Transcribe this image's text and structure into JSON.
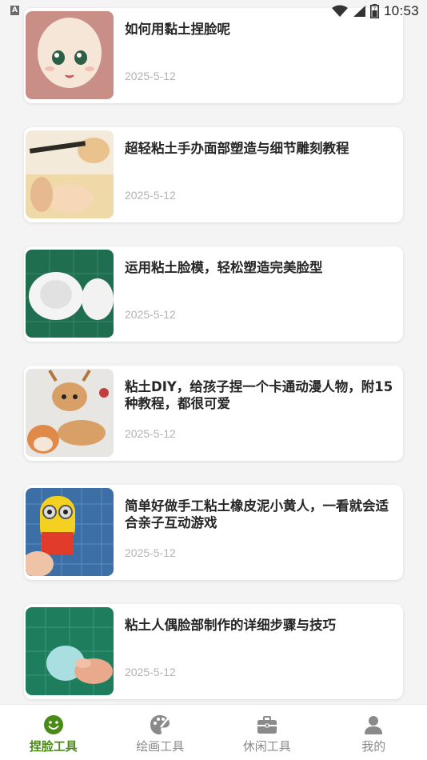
{
  "status_bar": {
    "badge": "A",
    "time": "10:53"
  },
  "articles": [
    {
      "title": "如何用黏土捏脸呢",
      "date": "2025-5-12",
      "thumb_icon": "clay-doll-face-image"
    },
    {
      "title": "超轻粘土手办面部塑造与细节雕刻教程",
      "date": "2025-5-12",
      "thumb_icon": "clay-face-sculpting-image"
    },
    {
      "title": "运用粘土脸模，轻松塑造完美脸型",
      "date": "2025-5-12",
      "thumb_icon": "clay-face-mold-image"
    },
    {
      "title": "粘土DIY，给孩子捏一个卡通动漫人物，附15种教程，都很可爱",
      "date": "2025-5-12",
      "thumb_icon": "clay-deer-figures-image"
    },
    {
      "title": "简单好做手工粘土橡皮泥小黄人，一看就会适合亲子互动游戏",
      "date": "2025-5-12",
      "thumb_icon": "clay-minion-image"
    },
    {
      "title": "粘土人偶脸部制作的详细步骤与技巧",
      "date": "2025-5-12",
      "thumb_icon": "clay-face-pressing-image"
    }
  ],
  "tabbar": {
    "tabs": [
      {
        "label": "捏脸工具",
        "icon": "smiley-icon",
        "active": true
      },
      {
        "label": "绘画工具",
        "icon": "palette-icon",
        "active": false
      },
      {
        "label": "休闲工具",
        "icon": "briefcase-icon",
        "active": false
      },
      {
        "label": "我的",
        "icon": "person-icon",
        "active": false
      }
    ]
  },
  "colors": {
    "accent": "#4a8a16",
    "inactive": "#8a8a8a",
    "date": "#b3b3b3"
  }
}
